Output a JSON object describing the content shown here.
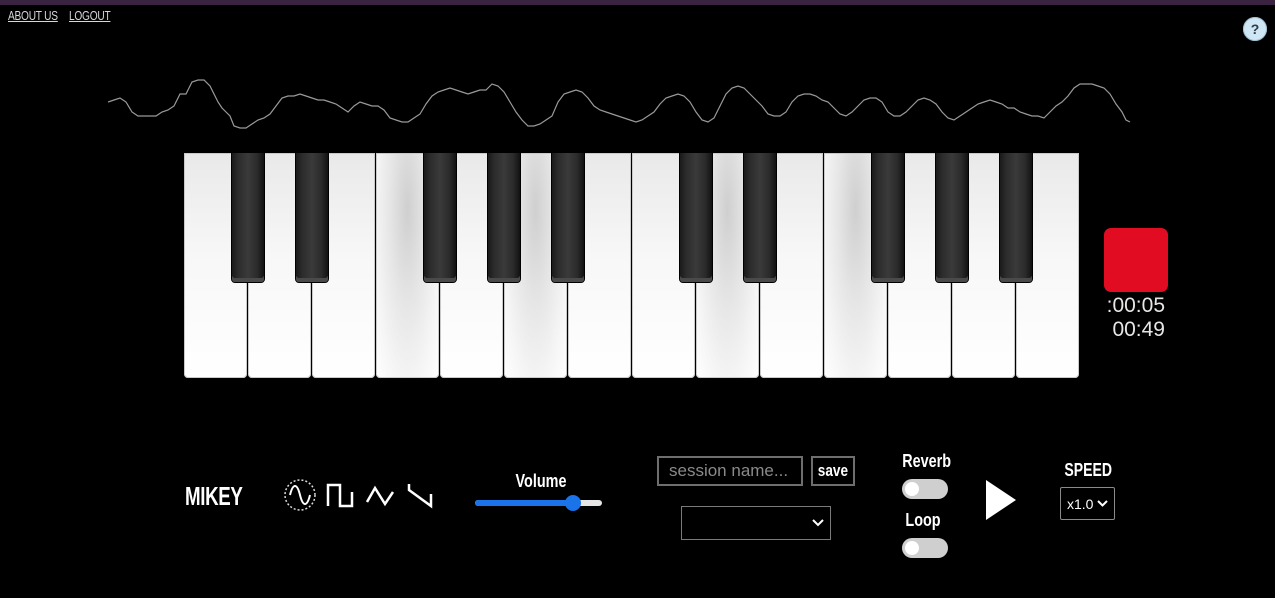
{
  "nav": {
    "about_label": "ABOUT US",
    "logout_label": "LOGOUT"
  },
  "help": {
    "label": "?"
  },
  "recorder": {
    "elapsed": ":00:05",
    "remaining": "00:49",
    "record_color": "#e20c22"
  },
  "user": {
    "name": "MIKEY"
  },
  "waveforms": {
    "icons": [
      "sine-wave-icon",
      "square-wave-icon",
      "triangle-wave-icon",
      "sawtooth-wave-icon"
    ],
    "selected": "sine"
  },
  "volume": {
    "label": "Volume",
    "value_fraction": 0.77,
    "accent": "#1a73e8"
  },
  "session": {
    "placeholder": "session name...",
    "save_label": "save",
    "selected": ""
  },
  "reverb": {
    "label": "Reverb",
    "on": false
  },
  "loop": {
    "label": "Loop",
    "on": false
  },
  "speed": {
    "label": "SPEED",
    "selected": "x1.0"
  },
  "keyboard": {
    "white_keys": 14,
    "pressed_white_keys": [
      3,
      5,
      8,
      10
    ]
  }
}
